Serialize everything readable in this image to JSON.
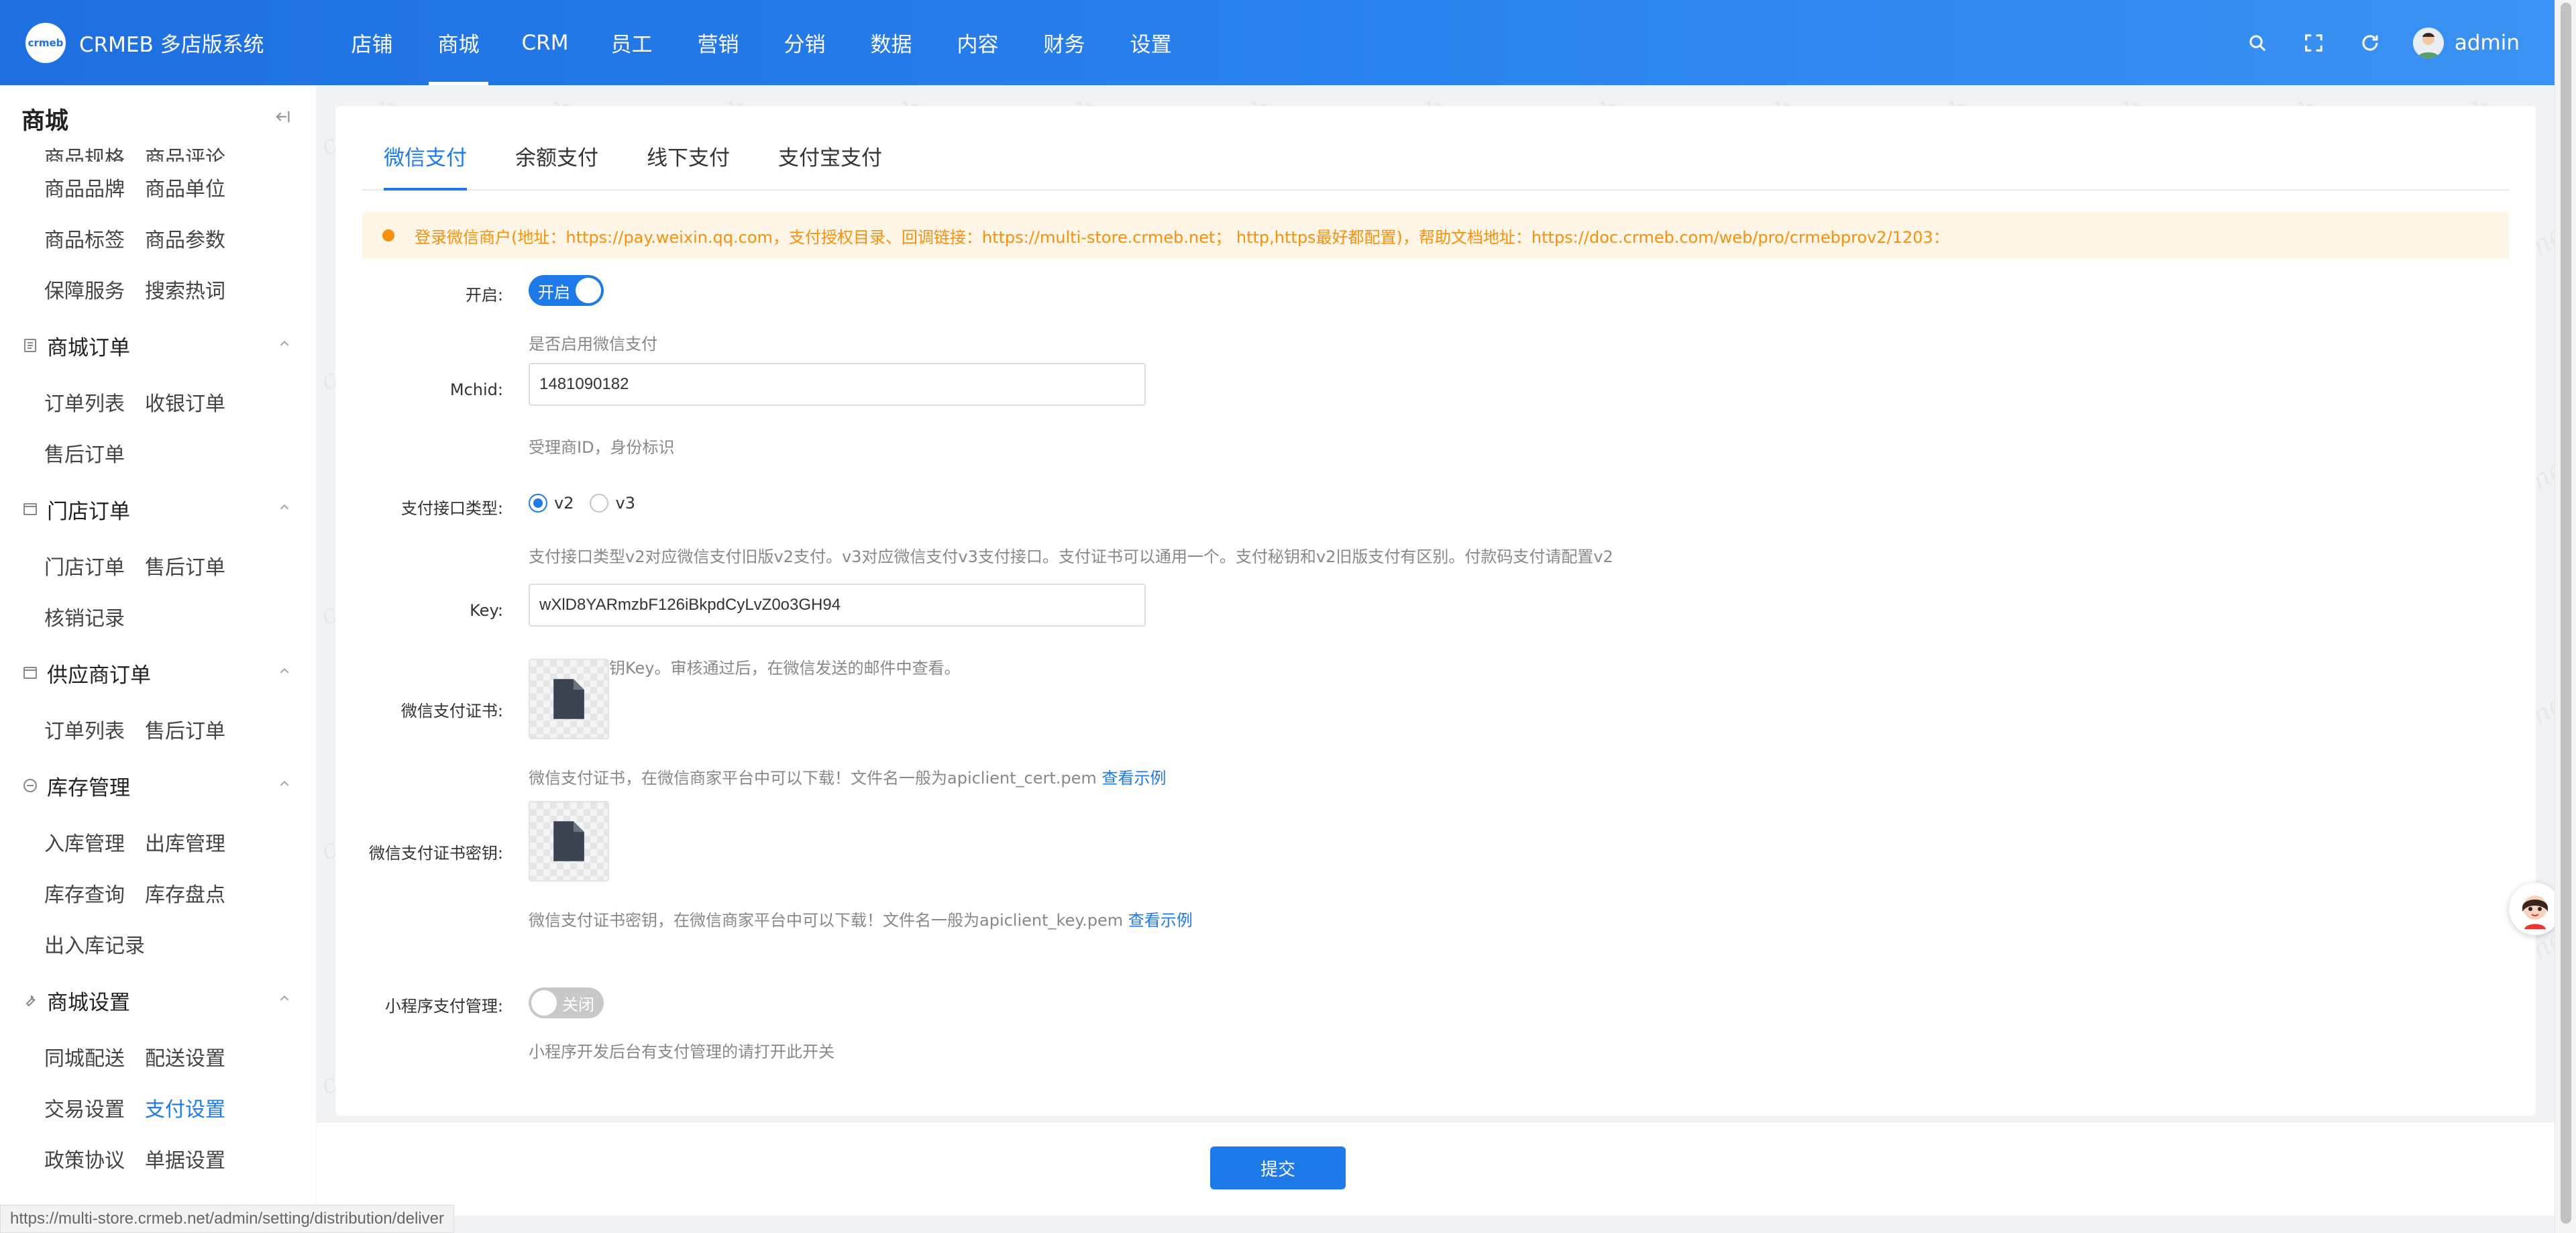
{
  "app": {
    "logo_mark": "crmeb",
    "title": "CRMEB 多店版系统",
    "brand_color": "#1e7ae8"
  },
  "topnav": {
    "items": [
      {
        "label": "店铺"
      },
      {
        "label": "商城"
      },
      {
        "label": "CRM"
      },
      {
        "label": "员工"
      },
      {
        "label": "营销"
      },
      {
        "label": "分销"
      },
      {
        "label": "数据"
      },
      {
        "label": "内容"
      },
      {
        "label": "财务"
      },
      {
        "label": "设置"
      }
    ],
    "active": "商城",
    "user": "admin",
    "icons": [
      "search-icon",
      "fullscreen-icon",
      "refresh-icon",
      "avatar"
    ]
  },
  "sidebar": {
    "title": "商城",
    "clipped_row": [
      "商品规格",
      "商品评论"
    ],
    "rows_top": [
      [
        "商品品牌",
        "商品单位"
      ],
      [
        "商品标签",
        "商品参数"
      ],
      [
        "保障服务",
        "搜索热词"
      ]
    ],
    "groups": [
      {
        "title": "商城订单",
        "icon": "document-icon",
        "rows": [
          [
            "订单列表",
            "收银订单"
          ],
          [
            "售后订单",
            ""
          ]
        ]
      },
      {
        "title": "门店订单",
        "icon": "window-icon",
        "rows": [
          [
            "门店订单",
            "售后订单"
          ],
          [
            "核销记录",
            ""
          ]
        ]
      },
      {
        "title": "供应商订单",
        "icon": "window-icon",
        "rows": [
          [
            "订单列表",
            "售后订单"
          ]
        ]
      },
      {
        "title": "库存管理",
        "icon": "circle-icon",
        "rows": [
          [
            "入库管理",
            "出库管理"
          ],
          [
            "库存查询",
            "库存盘点"
          ],
          [
            "出入库记录",
            ""
          ]
        ]
      },
      {
        "title": "商城设置",
        "icon": "wrench-icon",
        "rows": [
          [
            "同城配送",
            "配送设置"
          ],
          [
            "交易设置",
            "支付设置"
          ],
          [
            "政策协议",
            "单据设置"
          ]
        ]
      }
    ],
    "active_item": "支付设置"
  },
  "tabs": {
    "items": [
      "微信支付",
      "余额支付",
      "线下支付",
      "支付宝支付"
    ],
    "active": "微信支付"
  },
  "alert": {
    "text": "登录微信商户(地址：https://pay.weixin.qq.com，支付授权目录、回调链接：https://multi-store.crmeb.net；  http,https最好都配置)，帮助文档地址：https://doc.crmeb.com/web/pro/crmebprov2/1203："
  },
  "form": {
    "enable": {
      "label": "开启:",
      "switch_label": "开启",
      "state": "on",
      "help": "是否启用微信支付"
    },
    "mchid": {
      "label": "Mchid:",
      "value": "1481090182",
      "help": "受理商ID，身份标识"
    },
    "api_type": {
      "label": "支付接口类型:",
      "options": [
        "v2",
        "v3"
      ],
      "selected": "v2",
      "help": "支付接口类型v2对应微信支付旧版v2支付。v3对应微信支付v3支付接口。支付证书可以通用一个。支付秘钥和v2旧版支付有区别。付款码支付请配置v2"
    },
    "key": {
      "label": "Key:",
      "value": "wXlD8YARmzbF126iBkpdCyLvZ0o3GH94",
      "help": "商户支付密钥Key。审核通过后，在微信发送的邮件中查看。"
    },
    "cert": {
      "label": "微信支付证书:",
      "help": "微信支付证书，在微信商家平台中可以下载！文件名一般为apiclient_cert.pem",
      "link": "查看示例"
    },
    "cert_key": {
      "label": "微信支付证书密钥:",
      "help": "微信支付证书密钥，在微信商家平台中可以下载！文件名一般为apiclient_key.pem",
      "link": "查看示例"
    },
    "mini": {
      "label": "小程序支付管理:",
      "switch_label": "关闭",
      "state": "off",
      "help": "小程序开发后台有支付管理的请打开此开关"
    }
  },
  "submit": {
    "label": "提交"
  },
  "status_bar": {
    "url": "https://multi-store.crmeb.net/admin/setting/distribution/deliver"
  },
  "watermark": "crmeb"
}
